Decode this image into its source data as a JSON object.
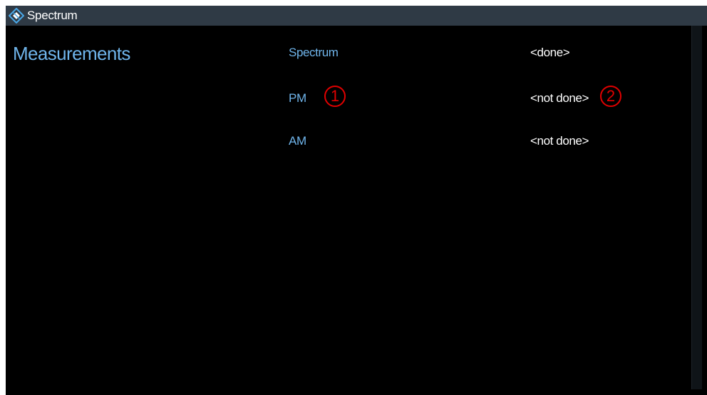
{
  "window": {
    "title": "Spectrum",
    "icon": "rs-diamond-icon"
  },
  "section": {
    "title": "Measurements"
  },
  "measurements": [
    {
      "name": "Spectrum",
      "status": "<done>"
    },
    {
      "name": "PM",
      "status": "<not done>"
    },
    {
      "name": "AM",
      "status": "<not done>"
    }
  ],
  "callouts": [
    "1",
    "2"
  ],
  "colors": {
    "titlebar": "#2f3a45",
    "background": "#000000",
    "accent_text": "#6fb4ea",
    "status_text": "#ffffff",
    "callout": "#e00000",
    "icon_blue": "#4aa8e8"
  }
}
